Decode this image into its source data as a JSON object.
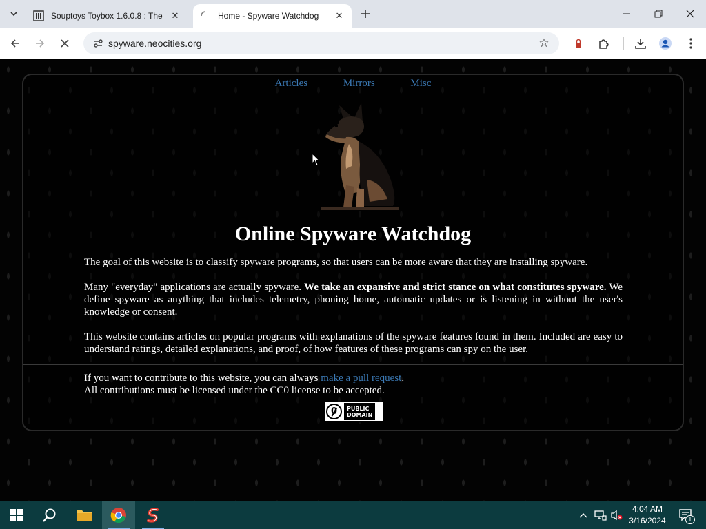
{
  "browser": {
    "tabs": [
      {
        "title": "Souptoys Toybox 1.6.0.8 : The S",
        "active": false
      },
      {
        "title": "Home - Spyware Watchdog",
        "active": true
      }
    ],
    "url": "spyware.neocities.org"
  },
  "page": {
    "nav": [
      "Articles",
      "Mirrors",
      "Misc"
    ],
    "heading": "Online Spyware Watchdog",
    "p1": "The goal of this website is to classify spyware programs, so that users can be more aware that they are installing spyware.",
    "p2_start": "Many \"everyday\" applications are actually spyware. ",
    "p2_bold": "We take an expansive and strict stance on what constitutes spyware.",
    "p2_end": " We define spyware as anything that includes telemetry, phoning home, automatic updates or is listening in without the user's knowledge or consent.",
    "p3": "This website contains articles on popular programs with explanations of the spyware features found in them. Included are easy to understand ratings, detailed explanations, and proof, of how features of these programs can spy on the user.",
    "contrib_start": "If you want to contribute to this website, you can always ",
    "contrib_link": "make a pull request",
    "contrib_end": ".",
    "contrib_line2": "All contributions must be licensed under the CC0 license to be accepted.",
    "badge_line1": "PUBLIC",
    "badge_line2": "DOMAIN"
  },
  "taskbar": {
    "time": "4:04 AM",
    "date": "3/16/2024",
    "notification_count": "1"
  },
  "colors": {
    "link": "#3b79b4",
    "taskbar": "#0c3b3f",
    "tabbar": "#dfe3ea"
  }
}
